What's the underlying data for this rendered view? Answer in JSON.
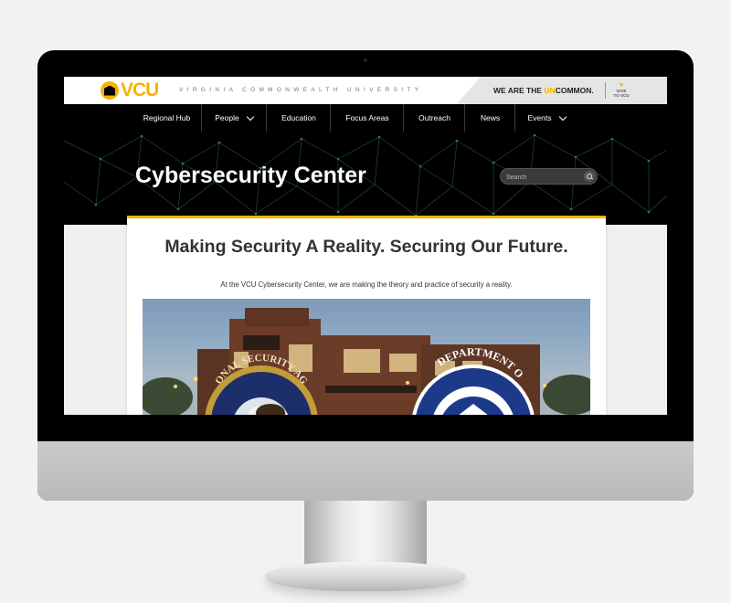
{
  "header": {
    "logo_text": "VCU",
    "university_name": "VIRGINIA COMMONWEALTH UNIVERSITY",
    "slogan_start": "WE ARE THE ",
    "slogan_accent": "UN",
    "slogan_end": "COMMON.",
    "give_line1": "GIVE",
    "give_line2": "TO VCU",
    "colors": {
      "gold": "#f8b300",
      "black": "#000000"
    }
  },
  "nav": {
    "items": [
      {
        "label": "Regional Hub",
        "has_dropdown": false
      },
      {
        "label": "People",
        "has_dropdown": true
      },
      {
        "label": "Education",
        "has_dropdown": false
      },
      {
        "label": "Focus Areas",
        "has_dropdown": false
      },
      {
        "label": "Outreach",
        "has_dropdown": false
      },
      {
        "label": "News",
        "has_dropdown": false
      },
      {
        "label": "Events",
        "has_dropdown": true
      }
    ]
  },
  "hero": {
    "title": "Cybersecurity Center",
    "search_placeholder": "Search",
    "search_icon": "magnifier-icon"
  },
  "main": {
    "headline": "Making Security A Reality. Securing Our Future.",
    "intro": "At the VCU Cybersecurity Center, we are making the theory and practice of security a reality.",
    "seal_left_text": "ONAL SECURITY AG",
    "seal_right_text": "DEPARTMENT O"
  }
}
